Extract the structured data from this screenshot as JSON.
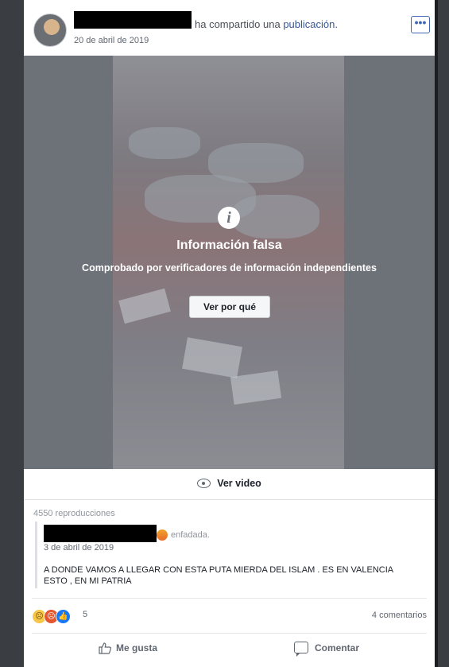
{
  "header": {
    "shared_text": "ha compartido una",
    "shared_link": "publicación.",
    "date": "20 de abril de 2019",
    "more_label": "•••"
  },
  "media": {
    "info_icon": "i",
    "warning_title": "Información falsa",
    "warning_subtitle": "Comprobado por verificadores de información independientes",
    "why_button": "Ver por qué"
  },
  "watch": {
    "label": "Ver video"
  },
  "views": "4550 reproducciones",
  "original_post": {
    "feeling": "enfadada.",
    "date": "3 de abril de 2019",
    "text": "A DONDE VAMOS A LLEGAR CON ESTA PUTA MIERDA DEL ISLAM . ES EN VALENCIA ESTO , EN MI PATRIA"
  },
  "reactions": {
    "count": "5",
    "comments": "4 comentarios",
    "icons": [
      "sad-reaction-icon",
      "angry-reaction-icon",
      "like-reaction-icon"
    ]
  },
  "actions": {
    "like_label": "Me gusta",
    "comment_label": "Comentar"
  },
  "colors": {
    "link": "#385898",
    "accent": "#4267b2"
  }
}
